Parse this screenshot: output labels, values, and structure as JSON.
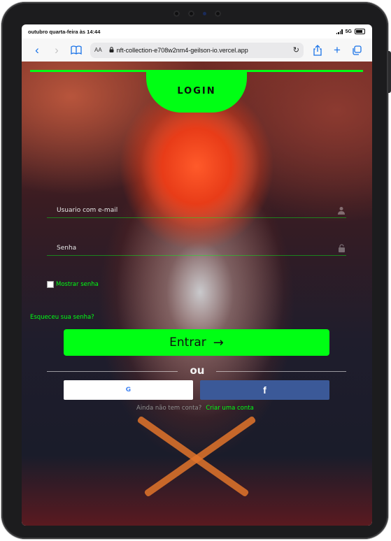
{
  "status_bar": {
    "datetime": "outubro quarta-feira às 14:44",
    "network": "5G"
  },
  "browser": {
    "text_size_label": "AA",
    "url": "nft-collection-e708w2nm4-geilson-io.vercel.app"
  },
  "login": {
    "title": "LOGIN",
    "email_placeholder": "Usuario com e-mail",
    "password_placeholder": "Senha",
    "show_password_label": "Mostrar senha",
    "forgot_password_label": "Esqueceu sua senha?",
    "submit_label": "Entrar",
    "or_label": "ou",
    "google_label": "G",
    "facebook_label": "f",
    "no_account_text": "Ainda não tem conta?",
    "create_account_label": "Criar uma conta"
  },
  "colors": {
    "accent": "#00ff14",
    "facebook": "#3b5998"
  }
}
